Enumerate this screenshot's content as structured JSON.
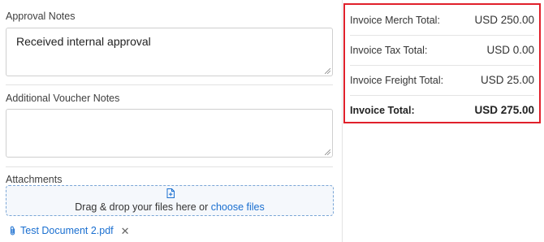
{
  "approval_notes": {
    "label": "Approval Notes",
    "value": "Received internal approval"
  },
  "voucher_notes": {
    "label": "Additional Voucher Notes",
    "value": ""
  },
  "attachments": {
    "label": "Attachments",
    "drop_text": "Drag & drop your files here or",
    "choose_link": "choose files",
    "files": [
      {
        "name": "Test Document 2.pdf",
        "icon": "paperclip-icon",
        "remove": "✕"
      }
    ]
  },
  "totals": {
    "highlight_color": "#e0202b",
    "rows": [
      {
        "label": "Invoice Merch Total:",
        "value": "USD 250.00"
      },
      {
        "label": "Invoice Tax Total:",
        "value": "USD 0.00"
      },
      {
        "label": "Invoice Freight Total:",
        "value": "USD 25.00"
      },
      {
        "label": "Invoice Total:",
        "value": "USD 275.00"
      }
    ]
  },
  "colors": {
    "link": "#1a6fd0",
    "dropzone_border": "#7aa6d6"
  }
}
